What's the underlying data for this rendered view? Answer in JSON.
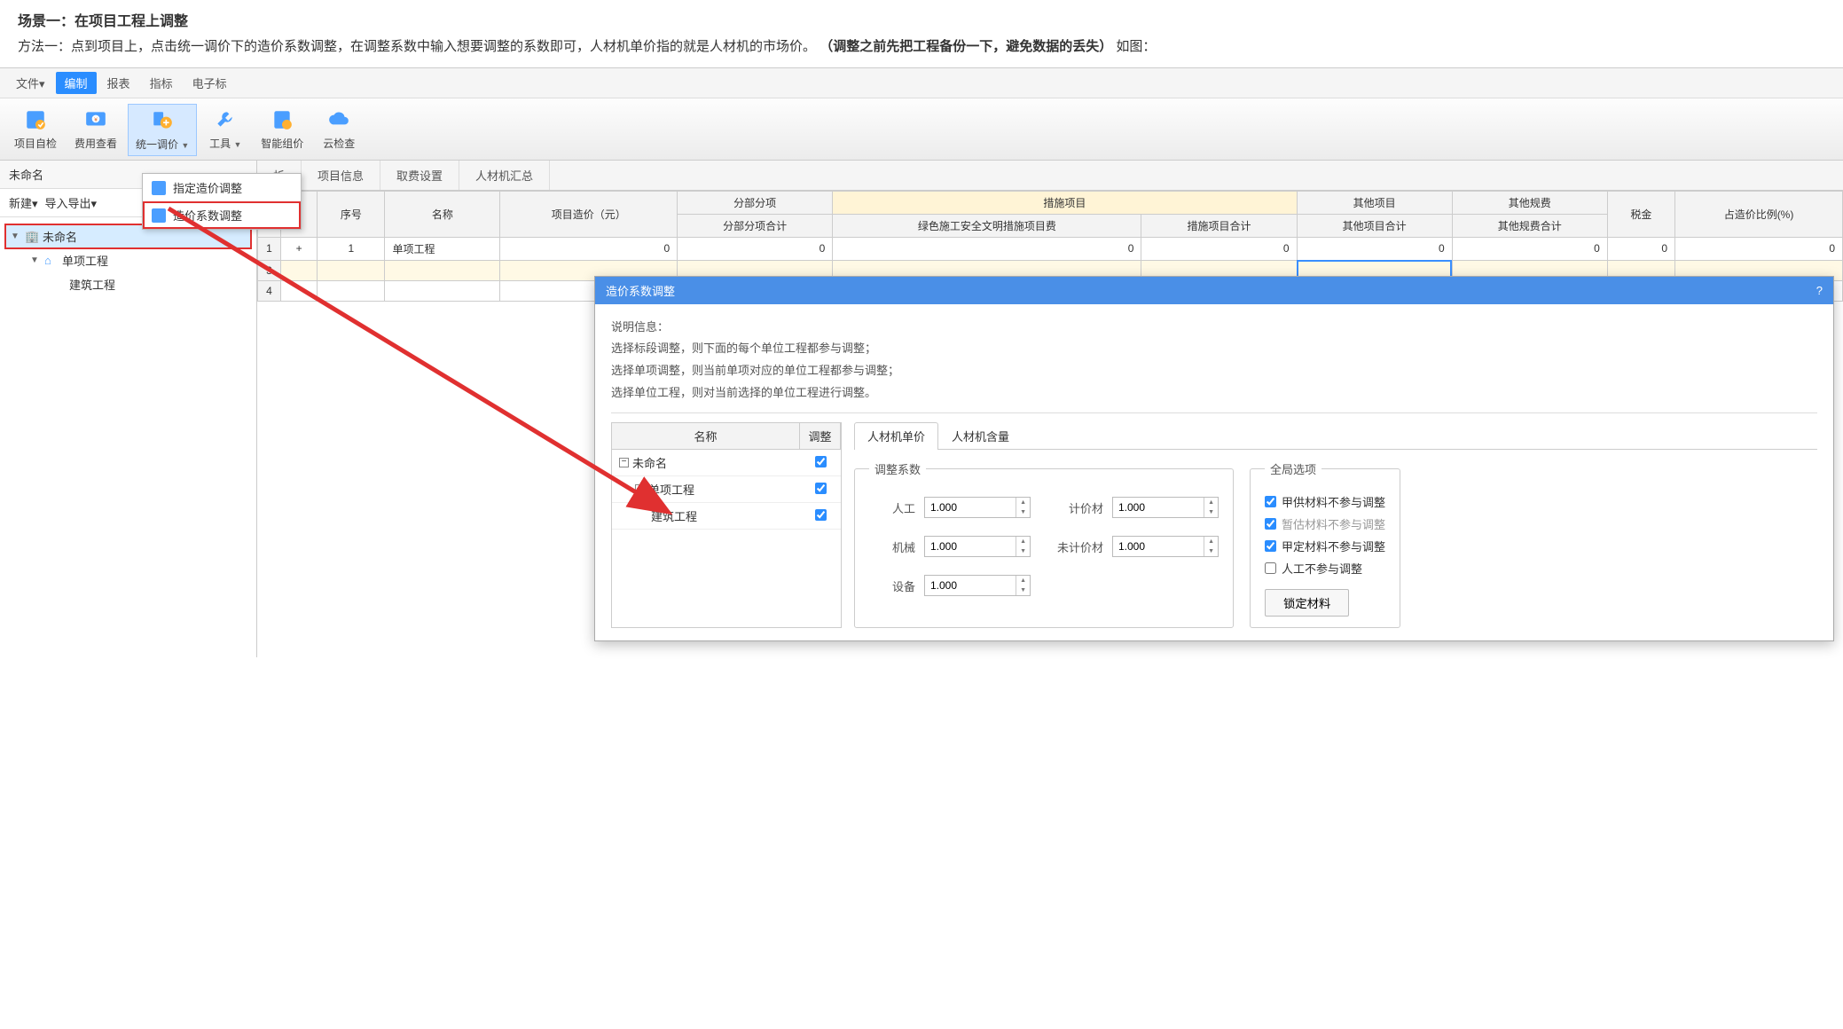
{
  "doc": {
    "scene_title": "场景一：在项目工程上调整",
    "method_text_1": "方法一：点到项目上，点击统一调价下的造价系数调整，在调整系数中输入想要调整的系数即可，人材机单价指的就是人材机的市场价。",
    "method_bold": "（调整之前先把工程备份一下，避免数据的丢失）",
    "method_tail": "如图："
  },
  "menubar": [
    "文件▾",
    "编制",
    "报表",
    "指标",
    "电子标"
  ],
  "menubar_active": 1,
  "toolbar": [
    {
      "label": "项目自检",
      "icon": "list-check"
    },
    {
      "label": "费用查看",
      "icon": "money-view"
    },
    {
      "label": "统一调价",
      "icon": "adjust",
      "arrow": true,
      "active": true
    },
    {
      "label": "工具",
      "icon": "tool",
      "arrow": true
    },
    {
      "label": "智能组价",
      "icon": "smart"
    },
    {
      "label": "云检查",
      "icon": "cloud"
    }
  ],
  "dropdown": [
    {
      "label": "指定造价调整"
    },
    {
      "label": "造价系数调整",
      "highlighted": true
    }
  ],
  "left": {
    "title": "未命名",
    "actions": [
      "新建▾",
      "导入导出▾"
    ],
    "tree": [
      {
        "label": "未命名",
        "icon": "building",
        "selected": true,
        "outlined": true,
        "caret": "▼",
        "indent": 0
      },
      {
        "label": "单项工程",
        "icon": "home",
        "caret": "▼",
        "indent": 1
      },
      {
        "label": "建筑工程",
        "icon": "",
        "indent": 2
      }
    ]
  },
  "tabs": [
    "析",
    "项目信息",
    "取费设置",
    "人材机汇总"
  ],
  "grid": {
    "header_row1": [
      "序号",
      "名称",
      "项目造价（元）",
      "分部分项",
      "措施项目",
      "",
      "其他项目",
      "其他规费",
      "税金",
      "占造价比例(%)"
    ],
    "header_row2": [
      "分部分项合计",
      "绿色施工安全文明措施项目费",
      "措施项目合计",
      "其他项目合计",
      "其他规费合计"
    ],
    "group_label": "措施项目",
    "rows": [
      {
        "rn": "1",
        "expand": "+",
        "seq": "1",
        "name": "单项工程",
        "vals": [
          "0",
          "0",
          "0",
          "0",
          "0",
          "0",
          "0",
          "0"
        ]
      },
      {
        "rn": "3",
        "selected": true,
        "cursor_col": 4
      },
      {
        "rn": "4"
      }
    ]
  },
  "dialog": {
    "title": "造价系数调整",
    "help": "?",
    "info_label": "说明信息：",
    "info_lines": [
      "选择标段调整，则下面的每个单位工程都参与调整；",
      "选择单项调整，则当前单项对应的单位工程都参与调整；",
      "选择单位工程，则对当前选择的单位工程进行调整。"
    ],
    "tree_headers": [
      "名称",
      "调整"
    ],
    "tree_rows": [
      {
        "label": "未命名",
        "indent": 0,
        "box": true,
        "checked": true
      },
      {
        "label": "单项工程",
        "indent": 1,
        "box": true,
        "checked": true
      },
      {
        "label": "建筑工程",
        "indent": 2,
        "checked": true
      }
    ],
    "inner_tabs": [
      "人材机单价",
      "人材机含量"
    ],
    "coef_legend": "调整系数",
    "coefs": [
      {
        "label": "人工",
        "value": "1.000"
      },
      {
        "label": "计价材",
        "value": "1.000"
      },
      {
        "label": "机械",
        "value": "1.000"
      },
      {
        "label": "未计价材",
        "value": "1.000"
      },
      {
        "label": "设备",
        "value": "1.000"
      }
    ],
    "global_legend": "全局选项",
    "global_opts": [
      {
        "label": "甲供材料不参与调整",
        "checked": true
      },
      {
        "label": "暂估材料不参与调整",
        "checked": true,
        "dim": true
      },
      {
        "label": "甲定材料不参与调整",
        "checked": true
      },
      {
        "label": "人工不参与调整",
        "checked": false
      }
    ],
    "lock_btn": "锁定材料"
  }
}
